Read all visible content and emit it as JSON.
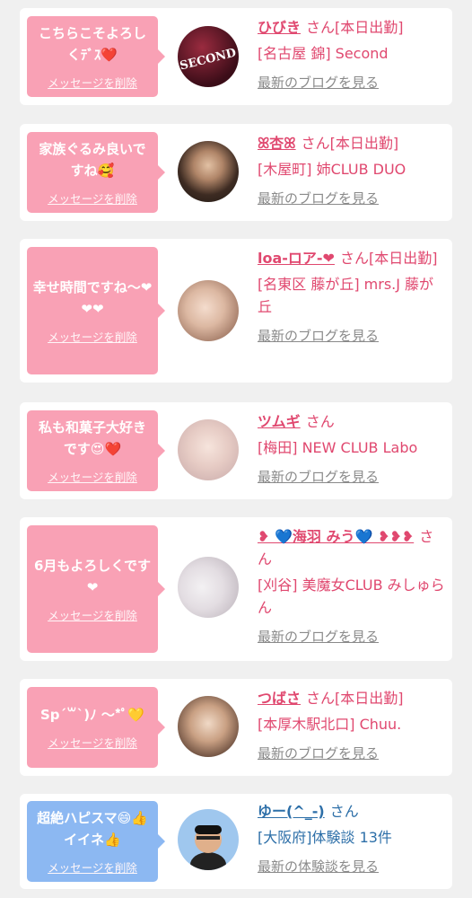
{
  "cards": [
    {
      "message": "こちらこそよろしくﾃﾞｽ❤️",
      "delete_label": "メッセージを削除",
      "name": "ひびき",
      "suffix": "さん[本日出勤]",
      "shop": "[名古屋 錦] Second",
      "link": "最新のブログを見る",
      "avatar_text": "SECOND"
    },
    {
      "message": "家族ぐるみ良いですね🥰",
      "delete_label": "メッセージを削除",
      "name": "ꕤ杏ꕤ",
      "suffix": "さん[本日出勤]",
      "shop": "[木屋町] 姉CLUB DUO",
      "link": "最新のブログを見る"
    },
    {
      "message": "幸せ時間ですね〜❤❤❤",
      "delete_label": "メッセージを削除",
      "name": "loa-ロア-❤",
      "suffix": "さん[本日出勤]",
      "shop": "[名東区 藤が丘] mrs.J 藤が丘",
      "link": "最新のブログを見る"
    },
    {
      "message": "私も和菓子大好きです😍❤️",
      "delete_label": "メッセージを削除",
      "name": "ツムギ",
      "suffix": "さん",
      "shop": "[梅田] NEW CLUB Labo",
      "link": "最新のブログを見る"
    },
    {
      "message": "6月もよろしくです❤",
      "delete_label": "メッセージを削除",
      "name": "❥ 💙海羽 みう💙 ❥❥❥",
      "suffix": "さん",
      "shop": "[刈谷] 美魔女CLUB みしゅらん",
      "link": "最新のブログを見る"
    },
    {
      "message": "Sp´꒳`)ﾉ 〜*ﾟ💛",
      "delete_label": "メッセージを削除",
      "name": "つばさ",
      "suffix": "さん[本日出勤]",
      "shop": "[本厚木駅北口] Chuu.",
      "link": "最新のブログを見る"
    },
    {
      "message": "超絶ハピスマ😄👍イイネ👍",
      "delete_label": "メッセージを削除",
      "name": "ゆー(^_-)",
      "suffix": "さん",
      "shop": "[大阪府]体験談 13件",
      "link": "最新の体験談を見る"
    }
  ],
  "colors": {
    "pink": "#f9a1b5",
    "blue": "#8cb8f2",
    "name_pink": "#e0486f",
    "name_blue": "#2d6fa8"
  }
}
